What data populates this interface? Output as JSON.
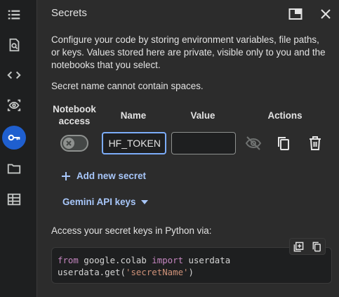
{
  "rail": {
    "items": [
      {
        "icon": "list-icon"
      },
      {
        "icon": "search-doc-icon"
      },
      {
        "icon": "code-icon"
      },
      {
        "icon": "eye-icon"
      },
      {
        "icon": "key-icon",
        "active": true
      },
      {
        "icon": "folder-icon"
      },
      {
        "icon": "table-icon"
      }
    ],
    "active_color": "#1f5fcf"
  },
  "panel": {
    "title": "Secrets",
    "description": "Configure your code by storing environment variables, file paths, or keys. Values stored here are private, visible only to you and the notebooks that you select.",
    "note": "Secret name cannot contain spaces.",
    "columns": {
      "notebook_access_line1": "Notebook",
      "notebook_access_line2": "access",
      "name": "Name",
      "value": "Value",
      "actions": "Actions"
    },
    "secret_row": {
      "name_value": "HF_TOKEN",
      "value_value": "",
      "access_enabled": false
    },
    "add_secret_label": "Add new secret",
    "gemini_label": "Gemini API keys",
    "access_label": "Access your secret keys in Python via:",
    "code": {
      "line1": {
        "kw1": "from",
        "mod": " google.colab ",
        "kw2": "import",
        "name": " userdata"
      },
      "line2": {
        "pre": "userdata.get(",
        "str": "'secretName'",
        "post": ")"
      }
    },
    "accent_color": "#a8c7fa"
  }
}
